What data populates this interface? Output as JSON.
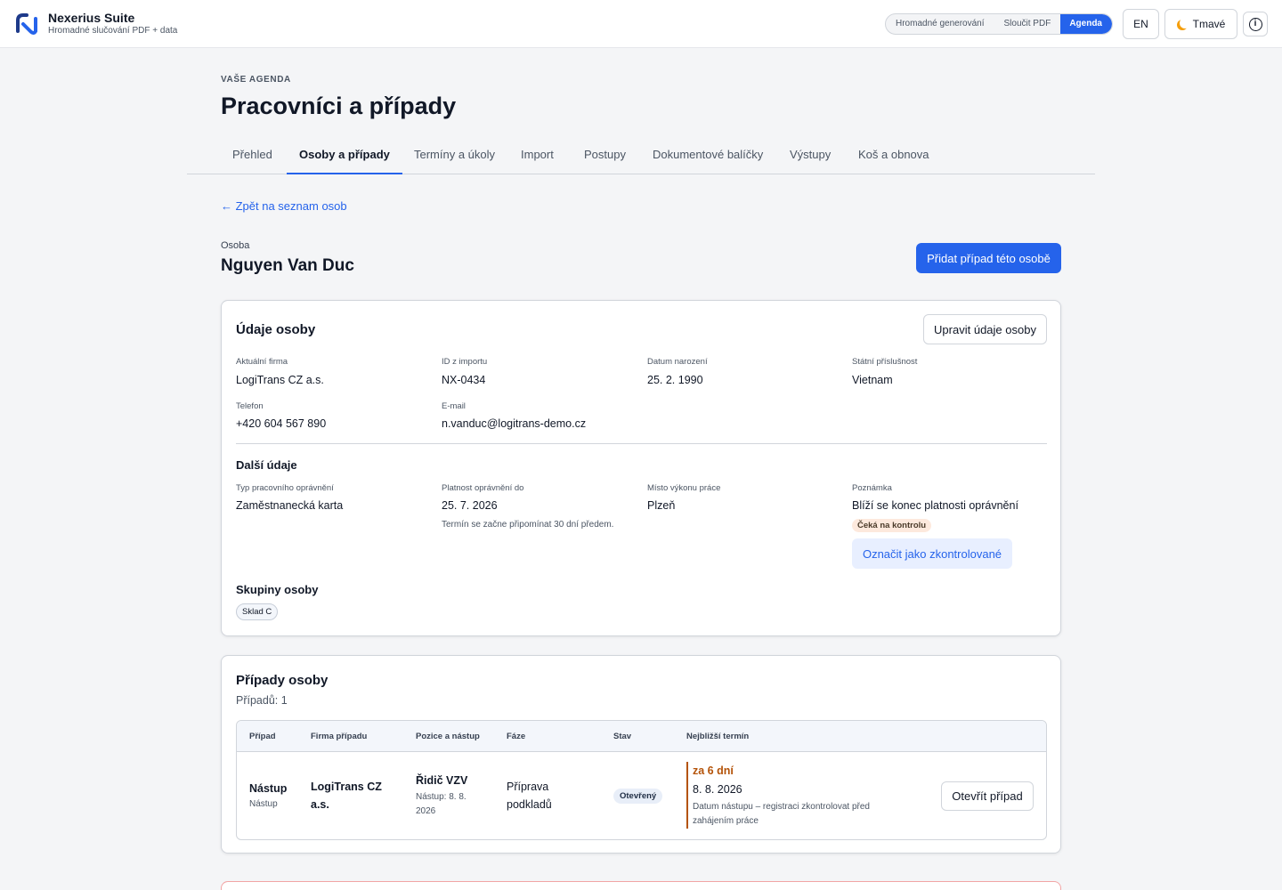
{
  "app": {
    "name": "Nexerius Suite",
    "subtitle": "Hromadné slučování PDF + data"
  },
  "modes": [
    {
      "label": "Hromadné generování",
      "active": false
    },
    {
      "label": "Sloučit PDF",
      "active": false
    },
    {
      "label": "Agenda",
      "active": true
    }
  ],
  "topbar": {
    "lang_label": "EN",
    "theme_label": "Tmavé",
    "theme_icon": "moon-icon",
    "info_icon": "info-icon",
    "info_glyph": "i"
  },
  "header": {
    "eyebrow": "VAŠE AGENDA",
    "title": "Pracovníci a případy"
  },
  "tabs": [
    {
      "label": "Přehled",
      "active": false
    },
    {
      "label": "Osoby a případy",
      "active": true
    },
    {
      "label": "Termíny a úkoly",
      "active": false
    },
    {
      "label": "Import",
      "active": false
    },
    {
      "label": "Postupy",
      "active": false
    },
    {
      "label": "Dokumentové balíčky",
      "active": false
    },
    {
      "label": "Výstupy",
      "active": false
    },
    {
      "label": "Koš a obnova",
      "active": false
    }
  ],
  "back_link": "← Zpět na seznam osob",
  "person": {
    "label": "Osoba",
    "name": "Nguyen Van Duc",
    "add_case_label": "Přidat případ této osobě"
  },
  "details": {
    "title": "Údaje osoby",
    "edit_label": "Upravit údaje osoby",
    "fields": [
      {
        "label": "Aktuální firma",
        "value": "LogiTrans CZ a.s."
      },
      {
        "label": "ID z importu",
        "value": "NX-0434"
      },
      {
        "label": "Datum narození",
        "value": "25. 2. 1990"
      },
      {
        "label": "Státní příslušnost",
        "value": "Vietnam"
      },
      {
        "label": "Telefon",
        "value": "+420 604 567 890"
      },
      {
        "label": "E-mail",
        "value": "n.vanduc@logitrans-demo.cz"
      }
    ],
    "extra": {
      "title": "Další údaje",
      "fields": [
        {
          "label": "Typ pracovního oprávnění",
          "value": "Zaměstnanecká karta"
        },
        {
          "label": "Platnost oprávnění do",
          "value": "25. 7. 2026",
          "hint": "Termín se začne připomínat 30 dní předem."
        },
        {
          "label": "Místo výkonu práce",
          "value": "Plzeň"
        },
        {
          "label": "Poznámka",
          "value": "Blíží se konec platnosti oprávnění",
          "badge": "Čeká na kontrolu",
          "action": "Označit jako zkontrolované"
        }
      ]
    },
    "groups": {
      "title": "Skupiny osoby",
      "items": [
        "Sklad C"
      ]
    }
  },
  "cases": {
    "title": "Případy osoby",
    "count_label": "Případů: 1",
    "columns": [
      "Případ",
      "Firma případu",
      "Pozice a nástup",
      "Fáze",
      "Stav",
      "Nejbližší termín"
    ],
    "rows": [
      {
        "case": "Nástup",
        "case_sub": "Nástup",
        "company_line1": "LogiTrans CZ",
        "company_line2": "a.s.",
        "position": "Řidič VZV",
        "start_line1": "Nástup: 8. 8.",
        "start_line2": "2026",
        "phase_line1": "Příprava",
        "phase_line2": "podkladů",
        "status": "Otevřený",
        "due_in": "za 6 dní",
        "due_date": "8. 8. 2026",
        "due_note": "Datum nástupu – registraci zkontrolovat před zahájením práce",
        "open_label": "Otevřít případ"
      }
    ]
  },
  "colors": {
    "accent": "#2563eb",
    "warning": "#b45309",
    "danger_border": "#f2a5a5"
  }
}
